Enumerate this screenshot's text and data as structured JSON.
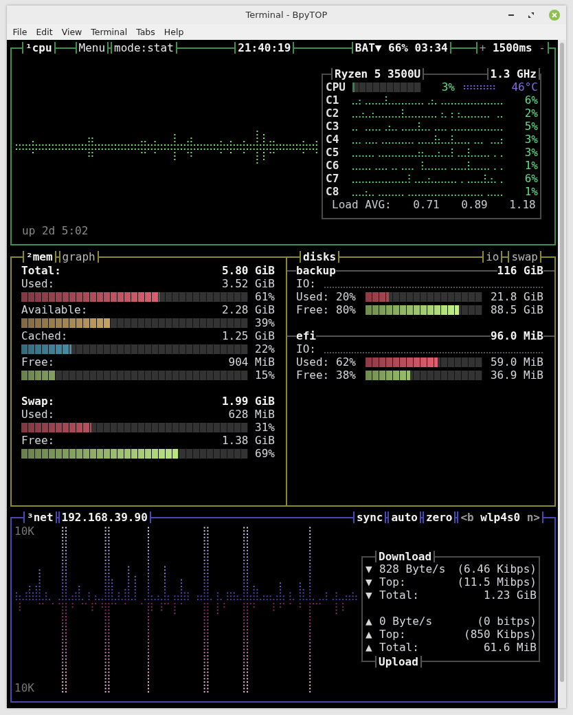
{
  "window": {
    "title": "Terminal - BpyTOP"
  },
  "menu": [
    "File",
    "Edit",
    "View",
    "Terminal",
    "Tabs",
    "Help"
  ],
  "cpu": {
    "tabs": [
      "¹cpu",
      "Menu",
      "mode:stat"
    ],
    "clock": "21:40:19",
    "battery": "BAT▼ 66% 03:34",
    "interval": {
      "plus": "+",
      "value": "1500ms",
      "minus": "-"
    },
    "uptime": "up 2d 5:02",
    "info": {
      "model": "Ryzen 5 3500U",
      "frequency": "1.3 GHz",
      "total": {
        "label": "CPU",
        "level": 0.03,
        "percent": "3%",
        "temperature": "46°C"
      },
      "cores": [
        {
          "label": "C1",
          "percent": "6%"
        },
        {
          "label": "C2",
          "percent": "2%"
        },
        {
          "label": "C3",
          "percent": "5%"
        },
        {
          "label": "C4",
          "percent": "3%"
        },
        {
          "label": "C5",
          "percent": "3%"
        },
        {
          "label": "C6",
          "percent": "1%"
        },
        {
          "label": "C7",
          "percent": "6%"
        },
        {
          "label": "C8",
          "percent": "1%"
        }
      ],
      "load_label": "Load AVG:",
      "load": [
        "0.71",
        "0.89",
        "1.18"
      ]
    }
  },
  "mem": {
    "title": "²mem",
    "options": [
      "graph"
    ],
    "sections": [
      {
        "label": "Total:",
        "value": "5.80 GiB",
        "items": [
          {
            "label": "Used:",
            "value": "3.52 GiB",
            "kind": "used",
            "level": 0.61,
            "percent": "61%"
          },
          {
            "label": "Available:",
            "value": "2.28 GiB",
            "kind": "available",
            "level": 0.39,
            "percent": "39%"
          },
          {
            "label": "Cached:",
            "value": "1.25 GiB",
            "kind": "cached",
            "level": 0.22,
            "percent": "22%"
          },
          {
            "label": "Free:",
            "value": "904 MiB",
            "kind": "free",
            "level": 0.15,
            "percent": "15%"
          }
        ]
      },
      {
        "label": "Swap:",
        "value": "1.99 GiB",
        "items": [
          {
            "label": "Used:",
            "value": "628 MiB",
            "kind": "used",
            "level": 0.31,
            "percent": "31%"
          },
          {
            "label": "Free:",
            "value": "1.38 GiB",
            "kind": "free",
            "level": 0.69,
            "percent": "69%"
          }
        ]
      }
    ]
  },
  "disks": {
    "title": "disks",
    "options": [
      "io",
      "swap"
    ],
    "items": [
      {
        "name": "backup",
        "size": "116 GiB",
        "io_label": "IO:",
        "rows": [
          {
            "label": "Used:",
            "percent": "20%",
            "kind": "used",
            "level": 0.2,
            "value": "21.8 GiB"
          },
          {
            "label": "Free:",
            "percent": "80%",
            "kind": "free",
            "level": 0.8,
            "value": "88.5 GiB"
          }
        ]
      },
      {
        "name": "efi",
        "size": "96.0 MiB",
        "io_label": "IO:",
        "rows": [
          {
            "label": "Used:",
            "percent": "62%",
            "kind": "used",
            "level": 0.62,
            "value": "59.0 MiB"
          },
          {
            "label": "Free:",
            "percent": "38%",
            "kind": "free",
            "level": 0.38,
            "value": "36.9 MiB"
          }
        ]
      }
    ]
  },
  "net": {
    "title": "³net",
    "address": "192.168.39.90",
    "options": [
      "sync",
      "auto",
      "zero"
    ],
    "interface": {
      "prev": "<b",
      "name": "wlp4s0",
      "next": "n>"
    },
    "scale_top": "10K",
    "scale_bottom": "10K",
    "download_title": "Download",
    "upload_title": "Upload",
    "download": [
      {
        "arrow": "▼",
        "label": "828 Byte/s",
        "value": "(6.46 Kibps)"
      },
      {
        "arrow": "▼",
        "label": "Top:",
        "value": "(11.5 Mibps)"
      },
      {
        "arrow": "▼",
        "label": "Total:",
        "value": "1.23 GiB"
      }
    ],
    "upload": [
      {
        "arrow": "▲",
        "label": "0 Byte/s",
        "value": "(0 bitps)"
      },
      {
        "arrow": "▲",
        "label": "Top:",
        "value": "(850 Kibps)"
      },
      {
        "arrow": "▲",
        "label": "Total:",
        "value": "61.6 MiB"
      }
    ]
  }
}
